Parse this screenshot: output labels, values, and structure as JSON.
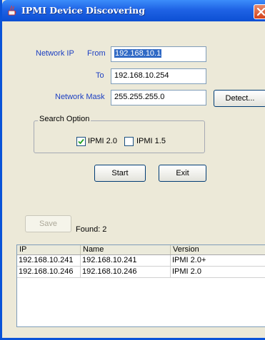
{
  "window": {
    "title": "IPMI Device Discovering"
  },
  "form": {
    "network_ip_label": "Network IP",
    "from_label": "From",
    "from_value": "192.168.10.1",
    "to_label": "To",
    "to_value": "192.168.10.254",
    "mask_label": "Network Mask",
    "mask_value": "255.255.255.0",
    "detect_label": "Detect..."
  },
  "search_option": {
    "title": "Search Option",
    "ipmi20": {
      "label": "IPMI 2.0",
      "checked": true
    },
    "ipmi15": {
      "label": "IPMI 1.5",
      "checked": false
    }
  },
  "actions": {
    "start_label": "Start",
    "exit_label": "Exit"
  },
  "results": {
    "save_label": "Save",
    "found_text": "Found: 2",
    "columns": [
      "IP",
      "Name",
      "Version"
    ],
    "rows": [
      {
        "ip": "192.168.10.241",
        "name": "192.168.10.241",
        "version": "IPMI 2.0+"
      },
      {
        "ip": "192.168.10.246",
        "name": "192.168.10.246",
        "version": "IPMI 2.0"
      }
    ]
  }
}
